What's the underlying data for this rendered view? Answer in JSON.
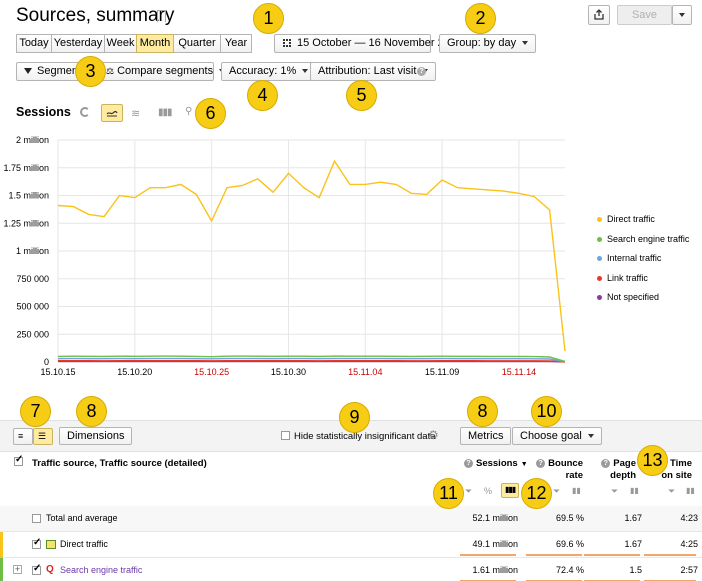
{
  "header": {
    "title": "Sources, summary",
    "save_label": "Save"
  },
  "periods": [
    "Today",
    "Yesterday",
    "Week",
    "Month",
    "Quarter",
    "Year"
  ],
  "active_period": "Month",
  "date_range": "15 October — 16 November 2015",
  "group_by": "Group: by day",
  "segment_label": "Segment",
  "compare_label": "Compare segments",
  "accuracy_label": "Accuracy: 1%",
  "attribution_label": "Attribution: Last visit",
  "sessions_label": "Sessions",
  "badges": [
    "1",
    "2",
    "3",
    "4",
    "5",
    "6",
    "7",
    "8",
    "9",
    "8",
    "10",
    "11",
    "12",
    "13"
  ],
  "chart_data": {
    "type": "line",
    "title": "",
    "ylabel": "",
    "xlabel": "",
    "ylim": [
      0,
      2000000
    ],
    "yticks": [
      "0",
      "250 000",
      "500 000",
      "750 000",
      "1 million",
      "1.25 million",
      "1.5 million",
      "1.75 million",
      "2 million"
    ],
    "xticks": [
      {
        "label": "15.10.15",
        "index": 0,
        "weekend": false
      },
      {
        "label": "15.10.20",
        "index": 5,
        "weekend": false
      },
      {
        "label": "15.10.25",
        "index": 10,
        "weekend": true
      },
      {
        "label": "15.10.30",
        "index": 15,
        "weekend": false
      },
      {
        "label": "15.11.04",
        "index": 20,
        "weekend": true
      },
      {
        "label": "15.11.09",
        "index": 25,
        "weekend": false
      },
      {
        "label": "15.11.14",
        "index": 30,
        "weekend": true
      }
    ],
    "series": [
      {
        "name": "Direct traffic",
        "color": "#f9c31a",
        "values": [
          1410000,
          1400000,
          1330000,
          1310000,
          1500000,
          1480000,
          1570000,
          1570000,
          1600000,
          1510000,
          1270000,
          1570000,
          1590000,
          1650000,
          1530000,
          1700000,
          1570000,
          1480000,
          1810000,
          1600000,
          1600000,
          1620000,
          1600000,
          1520000,
          1510000,
          1640000,
          1570000,
          1560000,
          1550000,
          1540000,
          1520000,
          1490000,
          1370000,
          100000
        ]
      },
      {
        "name": "Search engine traffic",
        "color": "#6cbe46",
        "values": [
          50000,
          52000,
          51000,
          50000,
          52000,
          51000,
          52000,
          53000,
          52000,
          50000,
          48000,
          52000,
          53000,
          52000,
          51000,
          52000,
          52000,
          50000,
          53000,
          52000,
          52000,
          52000,
          51000,
          50000,
          51000,
          52000,
          51000,
          51000,
          50000,
          50000,
          50000,
          49000,
          45000,
          5000
        ]
      },
      {
        "name": "Internal traffic",
        "color": "#6ea4e0",
        "values": [
          30000,
          31000,
          30000,
          30000,
          31000,
          30000,
          31000,
          31000,
          31000,
          30000,
          29000,
          31000,
          31000,
          31000,
          30000,
          31000,
          31000,
          30000,
          31000,
          31000,
          31000,
          31000,
          30000,
          30000,
          30000,
          31000,
          30000,
          30000,
          30000,
          30000,
          30000,
          29000,
          27000,
          3000
        ]
      },
      {
        "name": "Link traffic",
        "color": "#e8382c",
        "values": [
          12000,
          12000,
          12000,
          11000,
          12000,
          12000,
          12000,
          12000,
          12000,
          12000,
          11000,
          12000,
          12000,
          12000,
          12000,
          12000,
          12000,
          11000,
          12000,
          12000,
          12000,
          12000,
          12000,
          11000,
          11000,
          12000,
          12000,
          12000,
          11000,
          11000,
          11000,
          11000,
          10000,
          1000
        ]
      },
      {
        "name": "Not specified",
        "color": "#8e3a9c",
        "values": [
          5000,
          5000,
          5000,
          5000,
          5000,
          5000,
          5000,
          5000,
          5000,
          5000,
          5000,
          5000,
          5000,
          5000,
          5000,
          5000,
          5000,
          5000,
          5000,
          5000,
          5000,
          5000,
          5000,
          5000,
          5000,
          5000,
          5000,
          5000,
          5000,
          5000,
          5000,
          5000,
          5000,
          500
        ]
      }
    ]
  },
  "table_toolbar": {
    "dimensions_label": "Dimensions",
    "hide_insignificant_label": "Hide statistically insignificant data",
    "metrics_label": "Metrics",
    "choose_goal_label": "Choose goal"
  },
  "table": {
    "group_header": "Traffic source, Traffic source (detailed)",
    "columns": [
      {
        "label": "Sessions",
        "sorted": true
      },
      {
        "label": "Bounce rate"
      },
      {
        "label": "Page depth"
      },
      {
        "label": "Time on site"
      }
    ],
    "rows": [
      {
        "label": "Total and average",
        "sessions": "52.1 million",
        "bounce": "69.5 %",
        "depth": "1.67",
        "time": "4:23",
        "checked": false,
        "expander": false
      },
      {
        "label": "Direct traffic",
        "sessions": "49.1 million",
        "bounce": "69.6 %",
        "depth": "1.67",
        "time": "4:25",
        "checked": true,
        "expander": false
      },
      {
        "label": "Search engine traffic",
        "sessions": "1.61 million",
        "bounce": "72.4 %",
        "depth": "1.5",
        "time": "2:57",
        "checked": true,
        "expander": true
      }
    ]
  }
}
